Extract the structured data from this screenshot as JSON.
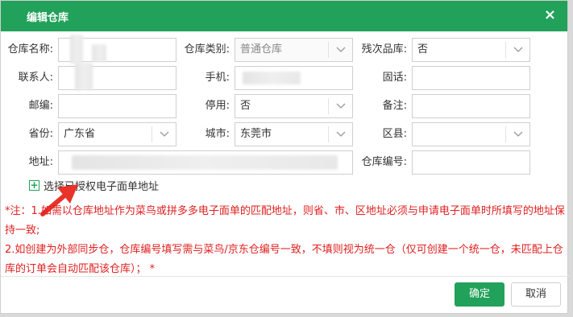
{
  "dialog": {
    "title": "编辑仓库",
    "close_glyph": "×"
  },
  "form": {
    "name_label": "仓库名称:",
    "name_value": "",
    "type_label": "仓库类别:",
    "type_value": "普通仓库",
    "defective_label": "残次品库:",
    "defective_value": "否",
    "contact_label": "联系人:",
    "contact_value": "",
    "phone_label": "手机:",
    "phone_value": "",
    "tel_label": "固话:",
    "tel_value": "",
    "zip_label": "邮编:",
    "zip_value": "",
    "disabled_label": "停用:",
    "disabled_value": "否",
    "remark_label": "备注:",
    "remark_value": "",
    "province_label": "省份:",
    "province_value": "广东省",
    "city_label": "城市:",
    "city_value": "东莞市",
    "district_label": "区县:",
    "district_value": "",
    "address_label": "地址:",
    "address_value": "",
    "code_label": "仓库编号:",
    "code_value": ""
  },
  "auth_link": {
    "icon": "+",
    "label": "选择已授权电子面单地址"
  },
  "notes": {
    "line1": "*注：1.如需以仓库地址作为菜鸟或拼多多电子面单的匹配地址，则省、市、区地址必须与申请电子面单时所填写的地址保持一致;",
    "line2": "2.如创建为外部同步仓，仓库编号填写需与菜鸟/京东仓编号一致，不填则视为统一仓（仅可创建一个统一仓，未匹配上仓库的订单会自动匹配该仓库）；  *"
  },
  "footer": {
    "ok_label": "确定",
    "cancel_label": "取消"
  },
  "colors": {
    "accent": "#22a15a",
    "note": "#e02020",
    "annotation_arrow": "#e8322a"
  }
}
